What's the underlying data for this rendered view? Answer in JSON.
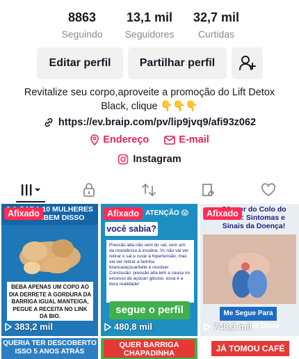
{
  "stats": [
    {
      "value": "8863",
      "label": "Seguindo"
    },
    {
      "value": "13,1 mil",
      "label": "Seguidores"
    },
    {
      "value": "32,7 mil",
      "label": "Curtidas"
    }
  ],
  "buttons": {
    "edit_profile": "Editar perfil",
    "share_profile": "Partilhar perfil",
    "add_friend_icon": "person-add-icon"
  },
  "bio": {
    "text": "Revitalize seu corpo,aproveite a promoção do Lift Detox Black, clique 👇👇👇",
    "link": "https://ev.braip.com/pv/lip9jvq9/afi93z062",
    "address": "Endereço",
    "email": "E-mail",
    "instagram": "Instagram"
  },
  "tabs": [
    {
      "icon": "grid-icon",
      "active": true
    },
    {
      "icon": "lock-icon",
      "active": false
    },
    {
      "icon": "repost-icon",
      "active": false
    },
    {
      "icon": "favorites-icon",
      "active": false
    },
    {
      "icon": "heart-icon",
      "active": false
    }
  ],
  "accent": "#fe2c55",
  "videos": [
    {
      "pinned": "Afixado",
      "views": "383,2 mil",
      "overlay_top": "9 A CADA 10 MULHERES NÃO SABEM DISSO",
      "caption": "BEBA APENAS UM COPO AO DIA DERRETE A GORDURA DA BARRIGA IGUAL MANTEIGA, PEGUE A RECEITA NO LINK DA BIO."
    },
    {
      "pinned": "Afixado",
      "views": "480,8 mil",
      "overlay_top": "ATENÇÃO 😱",
      "heading": "você sabia?",
      "body": "Pressão alta não vem do sal, vem sim da resistência à insulina. Vc não vai ver retirar o sal e curar a hipertensão, mas vai ver retirar a farinha branca/açúcar/leite e resolver. Conclusão: pressão alta tem a causa no excesso de açúcar/ glicose, essa é a dura realidade!",
      "cta": "segue o perfil"
    },
    {
      "pinned": "Afixado",
      "views": "748,3 mil",
      "heading": "Câncer do Colo do Útero: Sintomas e Sinais da Doença!",
      "cta": "Me Segue Para",
      "cta2": "Mais Dicas"
    },
    {
      "title": "QUERIA TER DESCOBERTO ISSO 5 ANOS ATRÁS"
    },
    {
      "title": "QUER BARRIGA CHAPADINHA"
    },
    {
      "title": "JÁ TOMOU CAFÉ"
    }
  ]
}
